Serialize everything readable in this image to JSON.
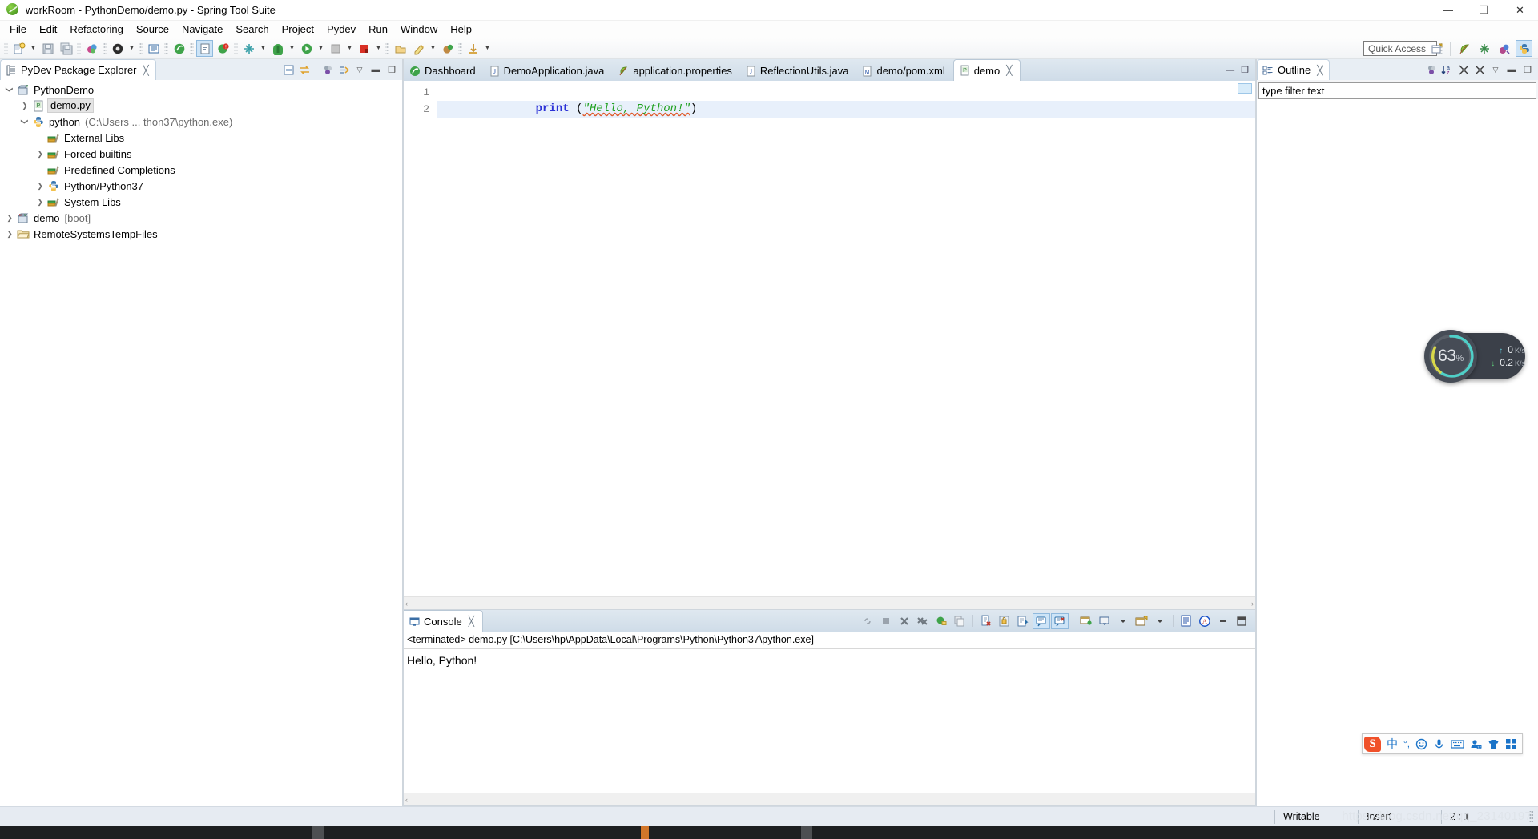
{
  "window": {
    "title": "workRoom - PythonDemo/demo.py - Spring Tool Suite",
    "app_icon": "sts-leaf-icon",
    "minimize": "—",
    "maximize": "❐",
    "close": "✕"
  },
  "menubar": {
    "items": [
      {
        "label": "File"
      },
      {
        "label": "Edit"
      },
      {
        "label": "Refactoring"
      },
      {
        "label": "Source"
      },
      {
        "label": "Navigate"
      },
      {
        "label": "Search"
      },
      {
        "label": "Project"
      },
      {
        "label": "Pydev"
      },
      {
        "label": "Run"
      },
      {
        "label": "Window"
      },
      {
        "label": "Help"
      }
    ]
  },
  "toolbar": {
    "quick_access_placeholder": "Quick Access",
    "buttons": [
      {
        "name": "new-wizard",
        "glyph": "🗋"
      },
      {
        "name": "save",
        "glyph": "💾"
      },
      {
        "name": "save-all",
        "glyph": "🗐"
      },
      {
        "name": "print",
        "glyph": "🖨"
      },
      {
        "name": "build-all",
        "glyph": "⚙"
      },
      {
        "name": "new-java-class",
        "glyph": "C"
      },
      {
        "name": "boot-dashboard",
        "glyph": "Ⓑ"
      },
      {
        "name": "open-type",
        "glyph": "Ⓣ"
      },
      {
        "name": "error-marker",
        "glyph": "!"
      },
      {
        "name": "debug",
        "glyph": "🐞"
      },
      {
        "name": "run",
        "glyph": "▶"
      },
      {
        "name": "run-external",
        "glyph": "▶"
      },
      {
        "name": "coverage",
        "glyph": "■"
      },
      {
        "name": "terminate",
        "glyph": "■"
      },
      {
        "name": "new-folder",
        "glyph": "🗀"
      },
      {
        "name": "pydev-package",
        "glyph": "✎"
      },
      {
        "name": "pydev-module",
        "glyph": "📦"
      },
      {
        "name": "pydev-interactive",
        "glyph": "↓"
      }
    ],
    "perspectives": [
      {
        "name": "open-perspective",
        "glyph": "⊞"
      },
      {
        "name": "spring-perspective",
        "glyph": "🍃"
      },
      {
        "name": "debug-perspective",
        "glyph": "✳"
      },
      {
        "name": "java-perspective",
        "glyph": "J"
      },
      {
        "name": "pydev-perspective",
        "glyph": "🐍",
        "active": true
      }
    ]
  },
  "explorer": {
    "tab_title": "PyDev Package Explorer",
    "tab_icon": "package-explorer-icon",
    "tab_close": "╳",
    "tools": [
      {
        "name": "collapse-all-icon",
        "glyph": "⊟"
      },
      {
        "name": "link-with-editor-icon",
        "glyph": "⇆"
      },
      {
        "name": "sep"
      },
      {
        "name": "filters-icon",
        "glyph": "⚪"
      },
      {
        "name": "view-menu-sort-icon",
        "glyph": "⇥"
      },
      {
        "name": "view-menu-icon",
        "glyph": "▽"
      },
      {
        "name": "minimize-icon",
        "glyph": "—"
      },
      {
        "name": "maximize-icon",
        "glyph": "❐"
      }
    ],
    "tree": [
      {
        "indent": 0,
        "twisty": "⌄",
        "icon": "python-project-icon",
        "label": "PythonDemo",
        "selected": false
      },
      {
        "indent": 1,
        "twisty": "›",
        "icon": "python-file-icon",
        "label": "demo.py",
        "selected": true
      },
      {
        "indent": 1,
        "twisty": "⌄",
        "icon": "python-interpreter-icon",
        "label": "python",
        "sub": "(C:\\Users ... thon37\\python.exe)",
        "selected": false
      },
      {
        "indent": 2,
        "twisty": "",
        "icon": "library-icon",
        "label": "External Libs",
        "selected": false
      },
      {
        "indent": 2,
        "twisty": "›",
        "icon": "library-icon",
        "label": "Forced builtins",
        "selected": false
      },
      {
        "indent": 2,
        "twisty": "",
        "icon": "library-icon",
        "label": "Predefined Completions",
        "selected": false
      },
      {
        "indent": 2,
        "twisty": "›",
        "icon": "python-interpreter-icon",
        "label": "Python/Python37",
        "selected": false
      },
      {
        "indent": 2,
        "twisty": "›",
        "icon": "library-icon",
        "label": "System Libs",
        "selected": false
      },
      {
        "indent": 0,
        "twisty": "›",
        "icon": "maven-project-icon",
        "label": "demo",
        "sub": "[boot]",
        "selected": false
      },
      {
        "indent": 0,
        "twisty": "›",
        "icon": "folder-icon",
        "label": "RemoteSystemsTempFiles",
        "selected": false
      }
    ]
  },
  "editor": {
    "tabs": [
      {
        "label": "Dashboard",
        "icon": "dashboard-icon",
        "active": false
      },
      {
        "label": "DemoApplication.java",
        "icon": "java-file-icon",
        "active": false
      },
      {
        "label": "application.properties",
        "icon": "properties-file-icon",
        "active": false
      },
      {
        "label": "ReflectionUtils.java",
        "icon": "java-file-icon",
        "active": false
      },
      {
        "label": "demo/pom.xml",
        "icon": "maven-pom-icon",
        "active": false
      },
      {
        "label": "demo",
        "icon": "python-file-icon",
        "active": true,
        "close": "╳"
      }
    ],
    "tools": [
      {
        "name": "minimize-icon",
        "glyph": "—"
      },
      {
        "name": "maximize-icon",
        "glyph": "❐"
      }
    ],
    "gutter": [
      "1",
      "2"
    ],
    "code": {
      "line1": {
        "keyword": "print",
        "space": " ",
        "open_paren": "(",
        "string": "\"Hello, Python!\"",
        "close_paren": ")"
      },
      "line2": ""
    },
    "scroll_left": "‹",
    "scroll_right": "›"
  },
  "console": {
    "tab_title": "Console",
    "tab_icon": "console-icon",
    "tab_close": "╳",
    "header": "<terminated> demo.py [C:\\Users\\hp\\AppData\\Local\\Programs\\Python\\Python37\\python.exe]",
    "output": "Hello, Python!",
    "tools": [
      {
        "name": "hide-console-icon",
        "glyph": "🔗",
        "toggled": false
      },
      {
        "name": "terminate-icon",
        "glyph": "■",
        "toggled": false
      },
      {
        "name": "remove-launch-icon",
        "glyph": "✕",
        "toggled": false
      },
      {
        "name": "remove-all-terminated-icon",
        "glyph": "✖",
        "toggled": false
      },
      {
        "name": "relaunch-icon",
        "glyph": "↺",
        "toggled": false
      },
      {
        "name": "copy-icon",
        "glyph": "⧉",
        "toggled": false
      },
      {
        "name": "sep1"
      },
      {
        "name": "clear-console-icon",
        "glyph": "🗒",
        "toggled": false
      },
      {
        "name": "lock-scroll-icon",
        "glyph": "🔒",
        "toggled": false
      },
      {
        "name": "word-wrap-icon",
        "glyph": "↵",
        "toggled": false
      },
      {
        "name": "show-console-on-output-icon",
        "glyph": "💬",
        "toggled": true
      },
      {
        "name": "show-console-on-error-icon",
        "glyph": "💬",
        "toggled": true
      },
      {
        "name": "sep2"
      },
      {
        "name": "pin-console-icon",
        "glyph": "📌",
        "toggled": false
      },
      {
        "name": "display-selected-console-icon",
        "glyph": "🖥",
        "toggled": false
      },
      {
        "name": "display-dropdown-icon",
        "glyph": "▾",
        "toggled": false
      },
      {
        "name": "open-console-icon",
        "glyph": "🗋",
        "toggled": false
      },
      {
        "name": "open-console-dropdown-icon",
        "glyph": "▾",
        "toggled": false
      },
      {
        "name": "sep3"
      },
      {
        "name": "view-menu-icon",
        "glyph": "📄",
        "toggled": false
      },
      {
        "name": "ansi-console-icon",
        "glyph": "Ⓐ",
        "toggled": false
      },
      {
        "name": "minimize-icon",
        "glyph": "—",
        "toggled": false
      },
      {
        "name": "maximize-icon",
        "glyph": "❐",
        "toggled": false
      }
    ],
    "scroll_left": "‹"
  },
  "outline": {
    "tab_title": "Outline",
    "tab_icon": "outline-icon",
    "tab_close": "╳",
    "filter_placeholder": "type filter text",
    "tools": [
      {
        "name": "filters-icon",
        "glyph": "⚪"
      },
      {
        "name": "sort-icon",
        "glyph": "↓a₂"
      },
      {
        "name": "collapse-all-icon",
        "glyph": "⤢"
      },
      {
        "name": "expand-all-icon",
        "glyph": "⤡"
      },
      {
        "name": "view-menu-icon",
        "glyph": "▽"
      },
      {
        "name": "minimize-icon",
        "glyph": "—"
      },
      {
        "name": "maximize-icon",
        "glyph": "❐"
      }
    ]
  },
  "statusbar": {
    "writable": "Writable",
    "insert": "Insert",
    "position": "2 : 1",
    "watermark": "https://blog.csdn.net/qq_23140197"
  },
  "net_widget": {
    "percent": "63",
    "percent_unit": "%",
    "upload_value": "0",
    "upload_unit": "K/s",
    "upload_arrow": "↑",
    "download_value": "0.2",
    "download_unit": "K/s",
    "download_arrow": "↓",
    "ring_color": "#4fd0c8",
    "ring_color2": "#d8d84a"
  },
  "ime": {
    "logo": "S",
    "items": [
      {
        "name": "chinese-mode-icon",
        "glyph": "中"
      },
      {
        "name": "punctuation-icon",
        "glyph": "°,"
      },
      {
        "name": "emoji-icon",
        "glyph": "☺"
      },
      {
        "name": "voice-input-icon",
        "glyph": "🎤"
      },
      {
        "name": "soft-keyboard-icon",
        "glyph": "⌨"
      },
      {
        "name": "user-icon",
        "glyph": "👤"
      },
      {
        "name": "skin-icon",
        "glyph": "👕"
      },
      {
        "name": "toolbox-icon",
        "glyph": "░"
      }
    ]
  }
}
